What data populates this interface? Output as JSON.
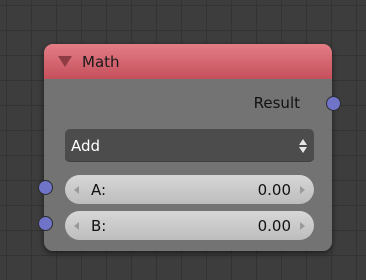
{
  "node": {
    "title": "Math",
    "output_label": "Result",
    "operation": "Add",
    "inputs": [
      {
        "label": "A:",
        "value": "0.00"
      },
      {
        "label": "B:",
        "value": "0.00"
      }
    ]
  },
  "colors": {
    "header": "#d8626d",
    "socket": "#6f74c9",
    "node_body": "#737373",
    "background": "#3d3d3d"
  },
  "icons": {
    "collapse": "triangle-down-icon",
    "dropdown": "up-down-arrows-icon",
    "decrement": "chevron-left-icon",
    "increment": "chevron-right-icon"
  }
}
